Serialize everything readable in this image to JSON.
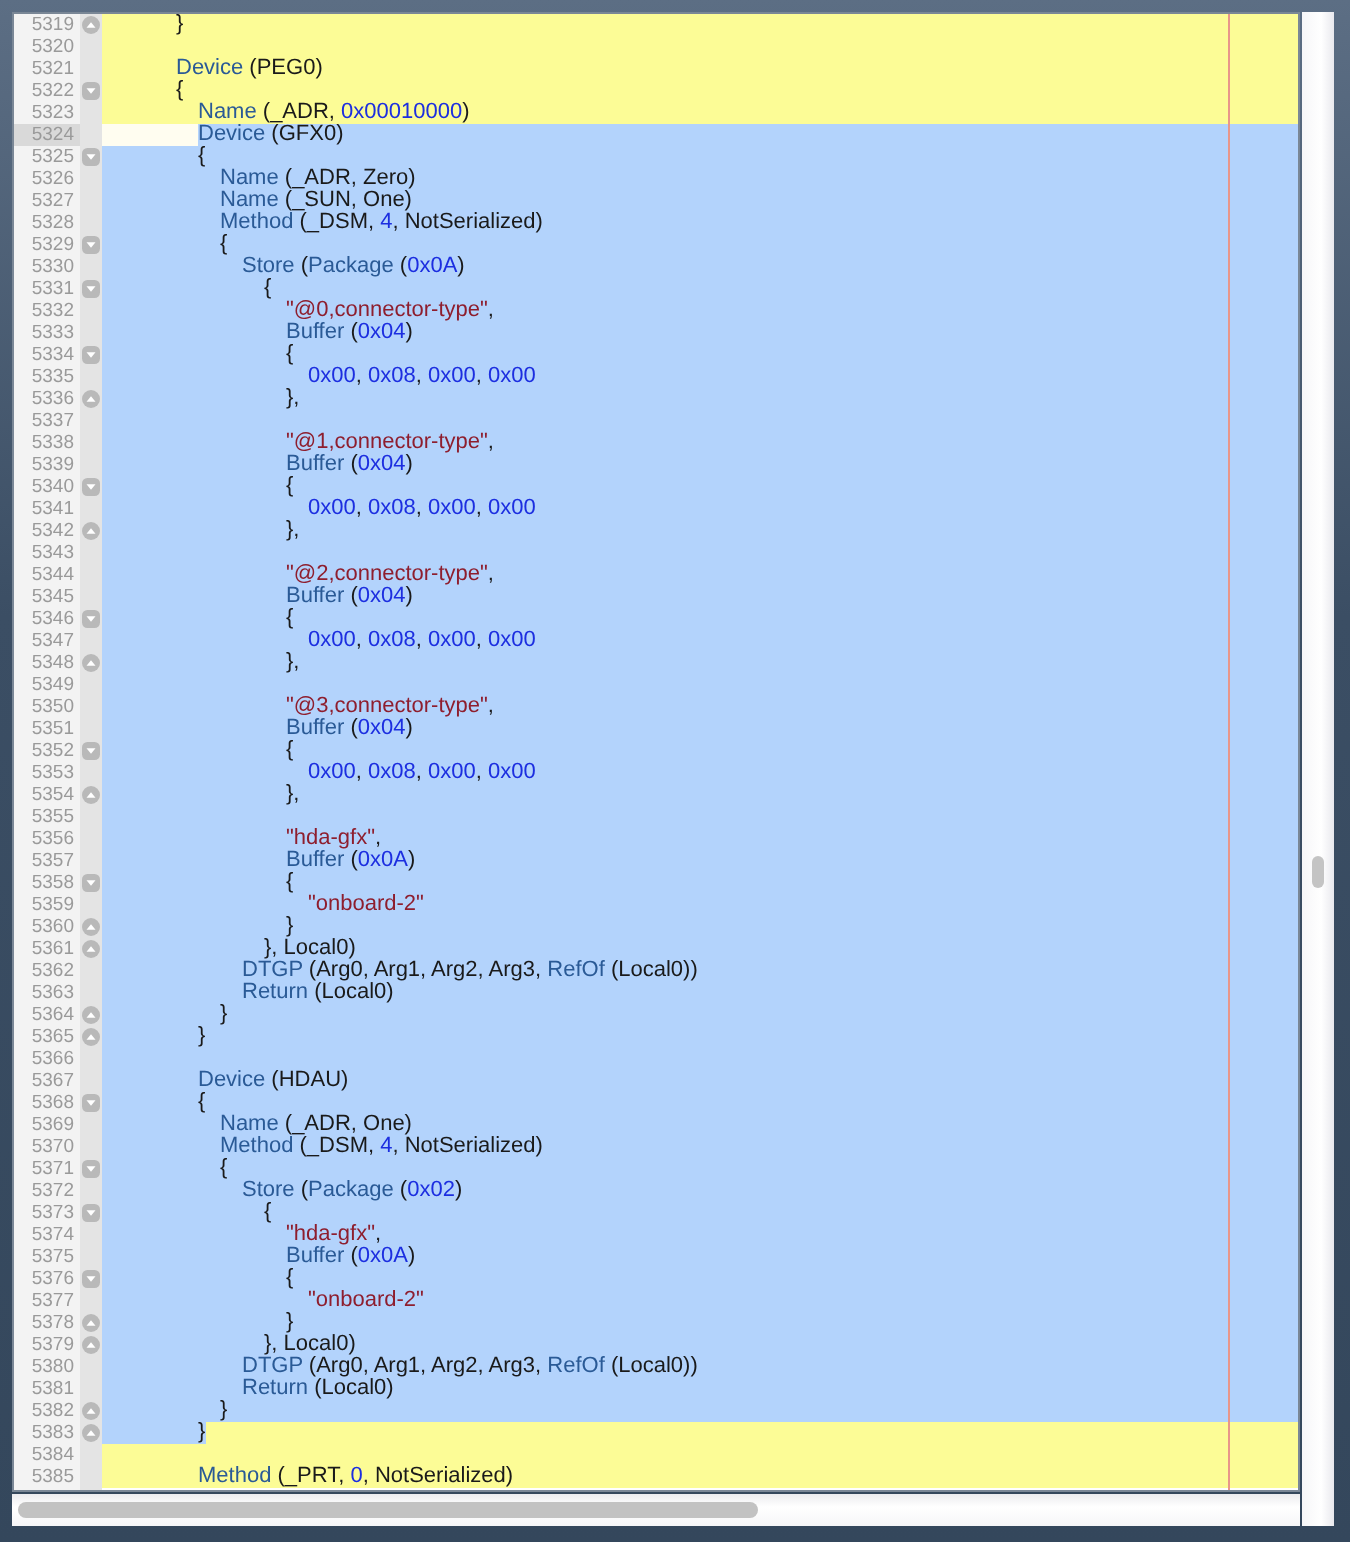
{
  "editor": {
    "lines": [
      {
        "number": "5319",
        "current": false,
        "selected": false,
        "fold_start": false,
        "fold_end": true,
        "code": [
          {
            "kind": "plain",
            "text": "\t\t\t}"
          }
        ]
      },
      {
        "number": "5320",
        "current": false,
        "selected": false,
        "fold_start": false,
        "fold_end": false
      },
      {
        "number": "5321",
        "current": false,
        "selected": false,
        "fold_start": false,
        "fold_end": false,
        "code": [
          {
            "kind": "keyword",
            "text": "\t\t\tDevice"
          },
          {
            "kind": "plain",
            "text": " (PEG0)"
          }
        ]
      },
      {
        "number": "5322",
        "current": false,
        "selected": false,
        "fold_start": true,
        "fold_end": false,
        "code": [
          {
            "kind": "plain",
            "text": "\t\t\t{"
          }
        ]
      },
      {
        "number": "5323",
        "current": false,
        "selected": false,
        "fold_start": false,
        "fold_end": false,
        "code": [
          {
            "kind": "keyword",
            "text": "\t\t\t\tName"
          },
          {
            "kind": "plain",
            "text": " (_ADR, "
          },
          {
            "kind": "number",
            "text": "0x00010000"
          },
          {
            "kind": "plain",
            "text": ")"
          }
        ]
      },
      {
        "number": "5324",
        "current": true,
        "selected": true,
        "fold_start": false,
        "fold_end": false,
        "code": [
          {
            "kind": "keyword",
            "text": "\t\t\t\tDevice"
          },
          {
            "kind": "plain",
            "text": " (GFX0)"
          }
        ]
      },
      {
        "number": "5325",
        "current": false,
        "selected": true,
        "fold_start": true,
        "fold_end": false,
        "code": [
          {
            "kind": "plain",
            "text": "\t\t\t\t{"
          }
        ]
      },
      {
        "number": "5326",
        "current": false,
        "selected": true,
        "fold_start": false,
        "fold_end": false,
        "code": [
          {
            "kind": "keyword",
            "text": "\t\t\t\t\tName"
          },
          {
            "kind": "plain",
            "text": " (_ADR, Zero)"
          }
        ]
      },
      {
        "number": "5327",
        "current": false,
        "selected": true,
        "fold_start": false,
        "fold_end": false,
        "code": [
          {
            "kind": "keyword",
            "text": "\t\t\t\t\tName"
          },
          {
            "kind": "plain",
            "text": " (_SUN, One)"
          }
        ]
      },
      {
        "number": "5328",
        "current": false,
        "selected": true,
        "fold_start": false,
        "fold_end": false,
        "code": [
          {
            "kind": "keyword",
            "text": "\t\t\t\t\tMethod"
          },
          {
            "kind": "plain",
            "text": " (_DSM, "
          },
          {
            "kind": "number",
            "text": "4"
          },
          {
            "kind": "plain",
            "text": ", NotSerialized)"
          }
        ]
      },
      {
        "number": "5329",
        "current": false,
        "selected": true,
        "fold_start": true,
        "fold_end": false,
        "code": [
          {
            "kind": "plain",
            "text": "\t\t\t\t\t{"
          }
        ]
      },
      {
        "number": "5330",
        "current": false,
        "selected": true,
        "fold_start": false,
        "fold_end": false,
        "code": [
          {
            "kind": "keyword",
            "text": "\t\t\t\t\t\tStore"
          },
          {
            "kind": "plain",
            "text": " ("
          },
          {
            "kind": "keyword",
            "text": "Package"
          },
          {
            "kind": "plain",
            "text": " ("
          },
          {
            "kind": "number",
            "text": "0x0A"
          },
          {
            "kind": "plain",
            "text": ")"
          }
        ]
      },
      {
        "number": "5331",
        "current": false,
        "selected": true,
        "fold_start": true,
        "fold_end": false,
        "code": [
          {
            "kind": "plain",
            "text": "\t\t\t\t\t\t\t{"
          }
        ]
      },
      {
        "number": "5332",
        "current": false,
        "selected": true,
        "fold_start": false,
        "fold_end": false,
        "code": [
          {
            "kind": "string",
            "text": "\t\t\t\t\t\t\t\t\"@0,connector-type\""
          },
          {
            "kind": "plain",
            "text": ","
          }
        ]
      },
      {
        "number": "5333",
        "current": false,
        "selected": true,
        "fold_start": false,
        "fold_end": false,
        "code": [
          {
            "kind": "keyword",
            "text": "\t\t\t\t\t\t\t\tBuffer"
          },
          {
            "kind": "plain",
            "text": " ("
          },
          {
            "kind": "number",
            "text": "0x04"
          },
          {
            "kind": "plain",
            "text": ")"
          }
        ]
      },
      {
        "number": "5334",
        "current": false,
        "selected": true,
        "fold_start": true,
        "fold_end": false,
        "code": [
          {
            "kind": "plain",
            "text": "\t\t\t\t\t\t\t\t{"
          }
        ]
      },
      {
        "number": "5335",
        "current": false,
        "selected": true,
        "fold_start": false,
        "fold_end": false,
        "code": [
          {
            "kind": "number",
            "text": "\t\t\t\t\t\t\t\t\t0x00"
          },
          {
            "kind": "plain",
            "text": ", "
          },
          {
            "kind": "number",
            "text": "0x08"
          },
          {
            "kind": "plain",
            "text": ", "
          },
          {
            "kind": "number",
            "text": "0x00"
          },
          {
            "kind": "plain",
            "text": ", "
          },
          {
            "kind": "number",
            "text": "0x00"
          }
        ]
      },
      {
        "number": "5336",
        "current": false,
        "selected": true,
        "fold_start": false,
        "fold_end": true,
        "code": [
          {
            "kind": "plain",
            "text": "\t\t\t\t\t\t\t\t},"
          }
        ]
      },
      {
        "number": "5337",
        "current": false,
        "selected": true,
        "fold_start": false,
        "fold_end": false
      },
      {
        "number": "5338",
        "current": false,
        "selected": true,
        "fold_start": false,
        "fold_end": false,
        "code": [
          {
            "kind": "string",
            "text": "\t\t\t\t\t\t\t\t\"@1,connector-type\""
          },
          {
            "kind": "plain",
            "text": ","
          }
        ]
      },
      {
        "number": "5339",
        "current": false,
        "selected": true,
        "fold_start": false,
        "fold_end": false,
        "code": [
          {
            "kind": "keyword",
            "text": "\t\t\t\t\t\t\t\tBuffer"
          },
          {
            "kind": "plain",
            "text": " ("
          },
          {
            "kind": "number",
            "text": "0x04"
          },
          {
            "kind": "plain",
            "text": ")"
          }
        ]
      },
      {
        "number": "5340",
        "current": false,
        "selected": true,
        "fold_start": true,
        "fold_end": false,
        "code": [
          {
            "kind": "plain",
            "text": "\t\t\t\t\t\t\t\t{"
          }
        ]
      },
      {
        "number": "5341",
        "current": false,
        "selected": true,
        "fold_start": false,
        "fold_end": false,
        "code": [
          {
            "kind": "number",
            "text": "\t\t\t\t\t\t\t\t\t0x00"
          },
          {
            "kind": "plain",
            "text": ", "
          },
          {
            "kind": "number",
            "text": "0x08"
          },
          {
            "kind": "plain",
            "text": ", "
          },
          {
            "kind": "number",
            "text": "0x00"
          },
          {
            "kind": "plain",
            "text": ", "
          },
          {
            "kind": "number",
            "text": "0x00"
          }
        ]
      },
      {
        "number": "5342",
        "current": false,
        "selected": true,
        "fold_start": false,
        "fold_end": true,
        "code": [
          {
            "kind": "plain",
            "text": "\t\t\t\t\t\t\t\t},"
          }
        ]
      },
      {
        "number": "5343",
        "current": false,
        "selected": true,
        "fold_start": false,
        "fold_end": false
      },
      {
        "number": "5344",
        "current": false,
        "selected": true,
        "fold_start": false,
        "fold_end": false,
        "code": [
          {
            "kind": "string",
            "text": "\t\t\t\t\t\t\t\t\"@2,connector-type\""
          },
          {
            "kind": "plain",
            "text": ","
          }
        ]
      },
      {
        "number": "5345",
        "current": false,
        "selected": true,
        "fold_start": false,
        "fold_end": false,
        "code": [
          {
            "kind": "keyword",
            "text": "\t\t\t\t\t\t\t\tBuffer"
          },
          {
            "kind": "plain",
            "text": " ("
          },
          {
            "kind": "number",
            "text": "0x04"
          },
          {
            "kind": "plain",
            "text": ")"
          }
        ]
      },
      {
        "number": "5346",
        "current": false,
        "selected": true,
        "fold_start": true,
        "fold_end": false,
        "code": [
          {
            "kind": "plain",
            "text": "\t\t\t\t\t\t\t\t{"
          }
        ]
      },
      {
        "number": "5347",
        "current": false,
        "selected": true,
        "fold_start": false,
        "fold_end": false,
        "code": [
          {
            "kind": "number",
            "text": "\t\t\t\t\t\t\t\t\t0x00"
          },
          {
            "kind": "plain",
            "text": ", "
          },
          {
            "kind": "number",
            "text": "0x08"
          },
          {
            "kind": "plain",
            "text": ", "
          },
          {
            "kind": "number",
            "text": "0x00"
          },
          {
            "kind": "plain",
            "text": ", "
          },
          {
            "kind": "number",
            "text": "0x00"
          }
        ]
      },
      {
        "number": "5348",
        "current": false,
        "selected": true,
        "fold_start": false,
        "fold_end": true,
        "code": [
          {
            "kind": "plain",
            "text": "\t\t\t\t\t\t\t\t},"
          }
        ]
      },
      {
        "number": "5349",
        "current": false,
        "selected": true,
        "fold_start": false,
        "fold_end": false
      },
      {
        "number": "5350",
        "current": false,
        "selected": true,
        "fold_start": false,
        "fold_end": false,
        "code": [
          {
            "kind": "string",
            "text": "\t\t\t\t\t\t\t\t\"@3,connector-type\""
          },
          {
            "kind": "plain",
            "text": ","
          }
        ]
      },
      {
        "number": "5351",
        "current": false,
        "selected": true,
        "fold_start": false,
        "fold_end": false,
        "code": [
          {
            "kind": "keyword",
            "text": "\t\t\t\t\t\t\t\tBuffer"
          },
          {
            "kind": "plain",
            "text": " ("
          },
          {
            "kind": "number",
            "text": "0x04"
          },
          {
            "kind": "plain",
            "text": ")"
          }
        ]
      },
      {
        "number": "5352",
        "current": false,
        "selected": true,
        "fold_start": true,
        "fold_end": false,
        "code": [
          {
            "kind": "plain",
            "text": "\t\t\t\t\t\t\t\t{"
          }
        ]
      },
      {
        "number": "5353",
        "current": false,
        "selected": true,
        "fold_start": false,
        "fold_end": false,
        "code": [
          {
            "kind": "number",
            "text": "\t\t\t\t\t\t\t\t\t0x00"
          },
          {
            "kind": "plain",
            "text": ", "
          },
          {
            "kind": "number",
            "text": "0x08"
          },
          {
            "kind": "plain",
            "text": ", "
          },
          {
            "kind": "number",
            "text": "0x00"
          },
          {
            "kind": "plain",
            "text": ", "
          },
          {
            "kind": "number",
            "text": "0x00"
          }
        ]
      },
      {
        "number": "5354",
        "current": false,
        "selected": true,
        "fold_start": false,
        "fold_end": true,
        "code": [
          {
            "kind": "plain",
            "text": "\t\t\t\t\t\t\t\t},"
          }
        ]
      },
      {
        "number": "5355",
        "current": false,
        "selected": true,
        "fold_start": false,
        "fold_end": false
      },
      {
        "number": "5356",
        "current": false,
        "selected": true,
        "fold_start": false,
        "fold_end": false,
        "code": [
          {
            "kind": "string",
            "text": "\t\t\t\t\t\t\t\t\"hda-gfx\""
          },
          {
            "kind": "plain",
            "text": ","
          }
        ]
      },
      {
        "number": "5357",
        "current": false,
        "selected": true,
        "fold_start": false,
        "fold_end": false,
        "code": [
          {
            "kind": "keyword",
            "text": "\t\t\t\t\t\t\t\tBuffer"
          },
          {
            "kind": "plain",
            "text": " ("
          },
          {
            "kind": "number",
            "text": "0x0A"
          },
          {
            "kind": "plain",
            "text": ")"
          }
        ]
      },
      {
        "number": "5358",
        "current": false,
        "selected": true,
        "fold_start": true,
        "fold_end": false,
        "code": [
          {
            "kind": "plain",
            "text": "\t\t\t\t\t\t\t\t{"
          }
        ]
      },
      {
        "number": "5359",
        "current": false,
        "selected": true,
        "fold_start": false,
        "fold_end": false,
        "code": [
          {
            "kind": "string",
            "text": "\t\t\t\t\t\t\t\t\t\"onboard-2\""
          }
        ]
      },
      {
        "number": "5360",
        "current": false,
        "selected": true,
        "fold_start": false,
        "fold_end": true,
        "code": [
          {
            "kind": "plain",
            "text": "\t\t\t\t\t\t\t\t}"
          }
        ]
      },
      {
        "number": "5361",
        "current": false,
        "selected": true,
        "fold_start": false,
        "fold_end": true,
        "code": [
          {
            "kind": "plain",
            "text": "\t\t\t\t\t\t\t}, Local0)"
          }
        ]
      },
      {
        "number": "5362",
        "current": false,
        "selected": true,
        "fold_start": false,
        "fold_end": false,
        "code": [
          {
            "kind": "keyword",
            "text": "\t\t\t\t\t\tDTGP"
          },
          {
            "kind": "plain",
            "text": " (Arg0, Arg1, Arg2, Arg3, "
          },
          {
            "kind": "keyword",
            "text": "RefOf"
          },
          {
            "kind": "plain",
            "text": " (Local0))"
          }
        ]
      },
      {
        "number": "5363",
        "current": false,
        "selected": true,
        "fold_start": false,
        "fold_end": false,
        "code": [
          {
            "kind": "keyword",
            "text": "\t\t\t\t\t\tReturn"
          },
          {
            "kind": "plain",
            "text": " (Local0)"
          }
        ]
      },
      {
        "number": "5364",
        "current": false,
        "selected": true,
        "fold_start": false,
        "fold_end": true,
        "code": [
          {
            "kind": "plain",
            "text": "\t\t\t\t\t}"
          }
        ]
      },
      {
        "number": "5365",
        "current": false,
        "selected": true,
        "fold_start": false,
        "fold_end": true,
        "code": [
          {
            "kind": "plain",
            "text": "\t\t\t\t}"
          }
        ]
      },
      {
        "number": "5366",
        "current": false,
        "selected": true,
        "fold_start": false,
        "fold_end": false
      },
      {
        "number": "5367",
        "current": false,
        "selected": true,
        "fold_start": false,
        "fold_end": false,
        "code": [
          {
            "kind": "keyword",
            "text": "\t\t\t\tDevice"
          },
          {
            "kind": "plain",
            "text": " (HDAU)"
          }
        ]
      },
      {
        "number": "5368",
        "current": false,
        "selected": true,
        "fold_start": true,
        "fold_end": false,
        "code": [
          {
            "kind": "plain",
            "text": "\t\t\t\t{"
          }
        ]
      },
      {
        "number": "5369",
        "current": false,
        "selected": true,
        "fold_start": false,
        "fold_end": false,
        "code": [
          {
            "kind": "keyword",
            "text": "\t\t\t\t\tName"
          },
          {
            "kind": "plain",
            "text": " (_ADR, One)"
          }
        ]
      },
      {
        "number": "5370",
        "current": false,
        "selected": true,
        "fold_start": false,
        "fold_end": false,
        "code": [
          {
            "kind": "keyword",
            "text": "\t\t\t\t\tMethod"
          },
          {
            "kind": "plain",
            "text": " (_DSM, "
          },
          {
            "kind": "number",
            "text": "4"
          },
          {
            "kind": "plain",
            "text": ", NotSerialized)"
          }
        ]
      },
      {
        "number": "5371",
        "current": false,
        "selected": true,
        "fold_start": true,
        "fold_end": false,
        "code": [
          {
            "kind": "plain",
            "text": "\t\t\t\t\t{"
          }
        ]
      },
      {
        "number": "5372",
        "current": false,
        "selected": true,
        "fold_start": false,
        "fold_end": false,
        "code": [
          {
            "kind": "keyword",
            "text": "\t\t\t\t\t\tStore"
          },
          {
            "kind": "plain",
            "text": " ("
          },
          {
            "kind": "keyword",
            "text": "Package"
          },
          {
            "kind": "plain",
            "text": " ("
          },
          {
            "kind": "number",
            "text": "0x02"
          },
          {
            "kind": "plain",
            "text": ")"
          }
        ]
      },
      {
        "number": "5373",
        "current": false,
        "selected": true,
        "fold_start": true,
        "fold_end": false,
        "code": [
          {
            "kind": "plain",
            "text": "\t\t\t\t\t\t\t{"
          }
        ]
      },
      {
        "number": "5374",
        "current": false,
        "selected": true,
        "fold_start": false,
        "fold_end": false,
        "code": [
          {
            "kind": "string",
            "text": "\t\t\t\t\t\t\t\t\"hda-gfx\""
          },
          {
            "kind": "plain",
            "text": ","
          }
        ]
      },
      {
        "number": "5375",
        "current": false,
        "selected": true,
        "fold_start": false,
        "fold_end": false,
        "code": [
          {
            "kind": "keyword",
            "text": "\t\t\t\t\t\t\t\tBuffer"
          },
          {
            "kind": "plain",
            "text": " ("
          },
          {
            "kind": "number",
            "text": "0x0A"
          },
          {
            "kind": "plain",
            "text": ")"
          }
        ]
      },
      {
        "number": "5376",
        "current": false,
        "selected": true,
        "fold_start": true,
        "fold_end": false,
        "code": [
          {
            "kind": "plain",
            "text": "\t\t\t\t\t\t\t\t{"
          }
        ]
      },
      {
        "number": "5377",
        "current": false,
        "selected": true,
        "fold_start": false,
        "fold_end": false,
        "code": [
          {
            "kind": "string",
            "text": "\t\t\t\t\t\t\t\t\t\"onboard-2\""
          }
        ]
      },
      {
        "number": "5378",
        "current": false,
        "selected": true,
        "fold_start": false,
        "fold_end": true,
        "code": [
          {
            "kind": "plain",
            "text": "\t\t\t\t\t\t\t\t}"
          }
        ]
      },
      {
        "number": "5379",
        "current": false,
        "selected": true,
        "fold_start": false,
        "fold_end": true,
        "code": [
          {
            "kind": "plain",
            "text": "\t\t\t\t\t\t\t}, Local0)"
          }
        ]
      },
      {
        "number": "5380",
        "current": false,
        "selected": true,
        "fold_start": false,
        "fold_end": false,
        "code": [
          {
            "kind": "keyword",
            "text": "\t\t\t\t\t\tDTGP"
          },
          {
            "kind": "plain",
            "text": " (Arg0, Arg1, Arg2, Arg3, "
          },
          {
            "kind": "keyword",
            "text": "RefOf"
          },
          {
            "kind": "plain",
            "text": " (Local0))"
          }
        ]
      },
      {
        "number": "5381",
        "current": false,
        "selected": true,
        "fold_start": false,
        "fold_end": false,
        "code": [
          {
            "kind": "keyword",
            "text": "\t\t\t\t\t\tReturn"
          },
          {
            "kind": "plain",
            "text": " (Local0)"
          }
        ]
      },
      {
        "number": "5382",
        "current": false,
        "selected": true,
        "fold_start": false,
        "fold_end": true,
        "code": [
          {
            "kind": "plain",
            "text": "\t\t\t\t\t}"
          }
        ]
      },
      {
        "number": "5383",
        "current": false,
        "selected": true,
        "fold_start": false,
        "fold_end": true,
        "code": [
          {
            "kind": "plain",
            "text": "\t\t\t\t}"
          }
        ]
      },
      {
        "number": "5384",
        "current": false,
        "selected": false,
        "fold_start": false,
        "fold_end": false
      },
      {
        "number": "5385",
        "current": false,
        "selected": false,
        "fold_start": false,
        "fold_end": false,
        "code": [
          {
            "kind": "keyword",
            "text": "\t\t\t\tMethod"
          },
          {
            "kind": "plain",
            "text": " (_PRT, "
          },
          {
            "kind": "number",
            "text": "0"
          },
          {
            "kind": "plain",
            "text": ", NotSerialized)"
          }
        ]
      }
    ]
  }
}
